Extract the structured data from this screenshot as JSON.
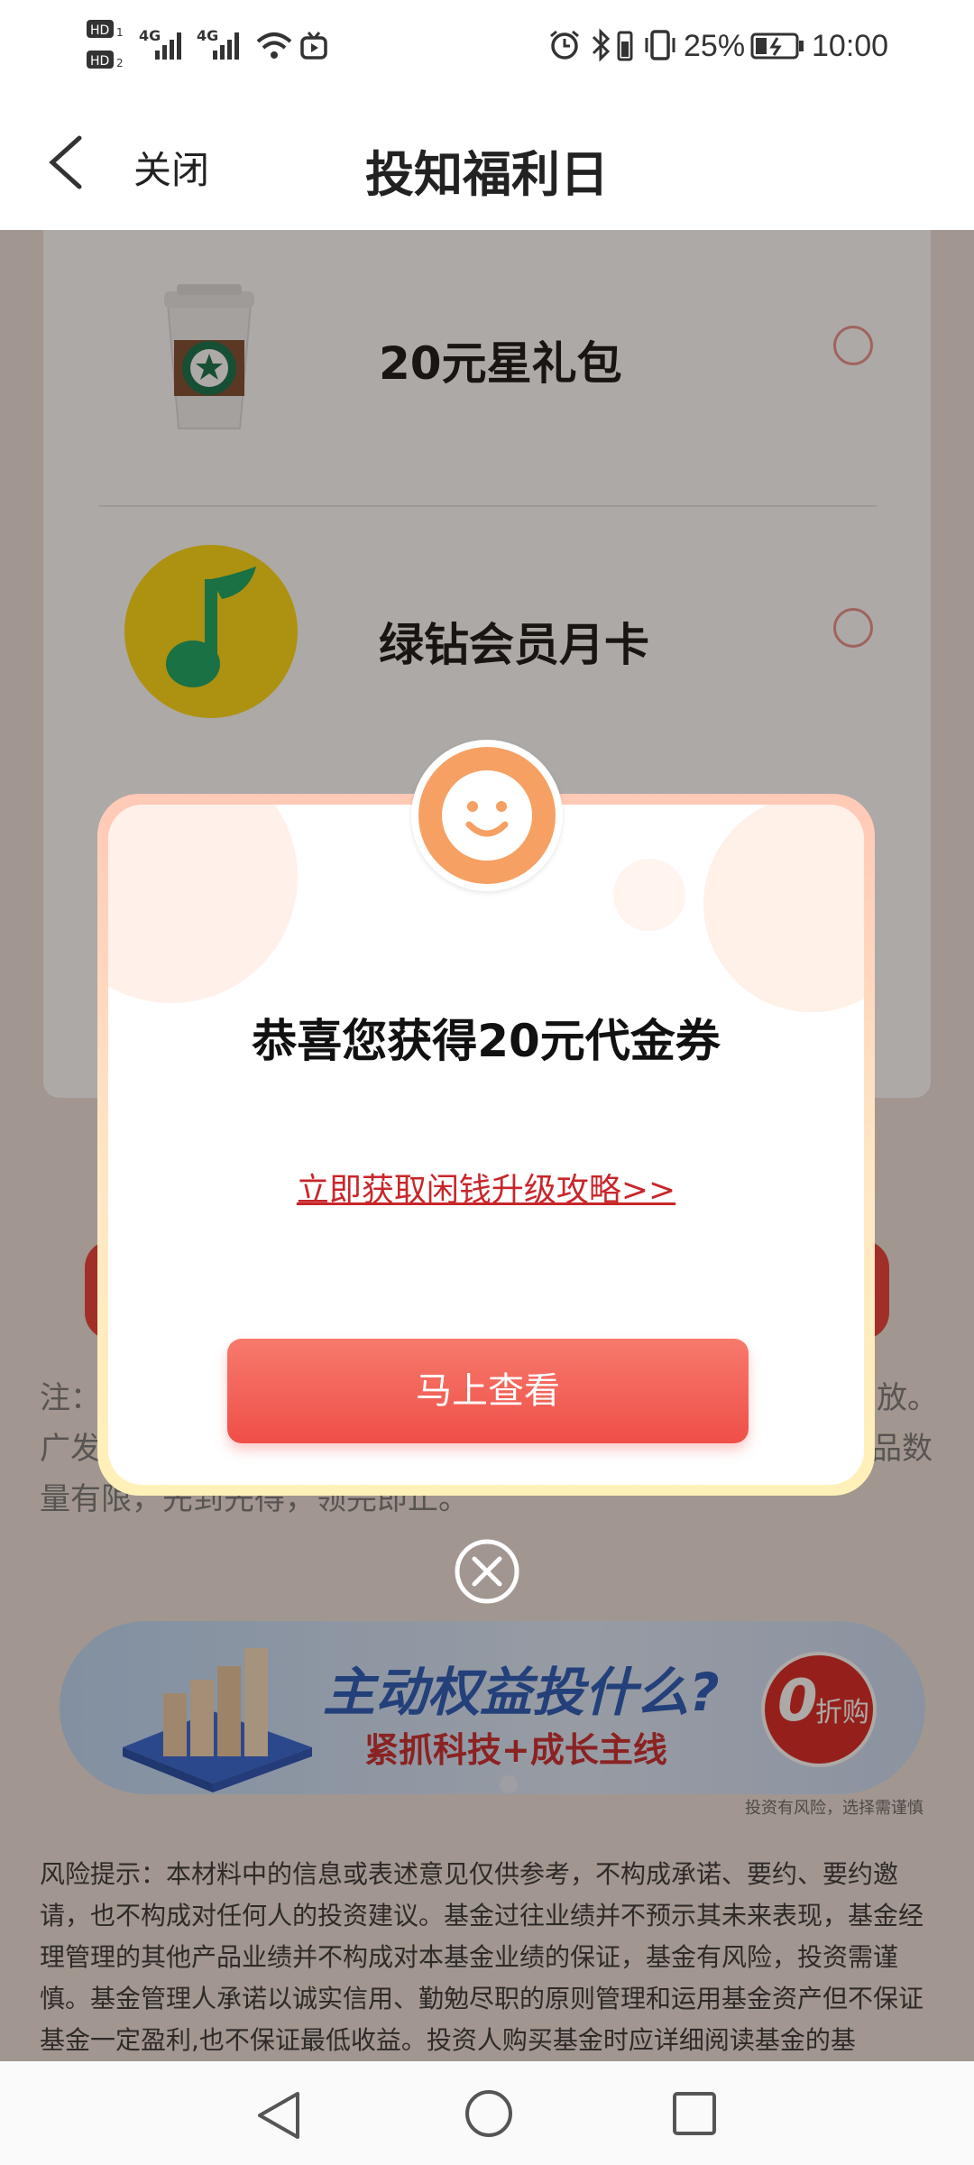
{
  "status_bar": {
    "network_label": "4G",
    "battery_percent": "25%",
    "time": "10:00"
  },
  "nav": {
    "close_label": "关闭",
    "title": "投知福利日"
  },
  "gifts": [
    {
      "title": "20元星礼包",
      "icon": "coffee-cup-icon"
    },
    {
      "title": "绿钻会员月卡",
      "icon": "music-note-icon"
    }
  ],
  "note": {
    "line1_start": "注：",
    "line1_end": "放。",
    "line2_start": "广发",
    "line2_end": "品数",
    "line3": "量有限，先到先得，领完即止。"
  },
  "banner": {
    "headline": "主动权益投什么?",
    "subline": "紧抓科技+成长主线",
    "badge_num": "0",
    "badge_text": "折购",
    "disclaimer": "投资有风险，选择需谨慎"
  },
  "risk_text": "风险提示：本材料中的信息或表述意见仅供参考，不构成承诺、要约、要约邀请，也不构成对任何人的投资建议。基金过往业绩并不预示其未来表现，基金经理管理的其他产品业绩并不构成对本基金业绩的保证，基金有风险，投资需谨慎。基金管理人承诺以诚实信用、勤勉尽职的原则管理和运用基金资产但不保证基金一定盈利,也不保证最低收益。投资人购买基金时应详细阅读基金的基",
  "dialog": {
    "title": "恭喜您获得20元代金券",
    "link": "立即获取闲钱升级攻略>>",
    "button": "马上查看"
  },
  "colors": {
    "accent_red": "#f0544c",
    "link_red": "#c8262a",
    "banner_blue": "#2156b8"
  }
}
